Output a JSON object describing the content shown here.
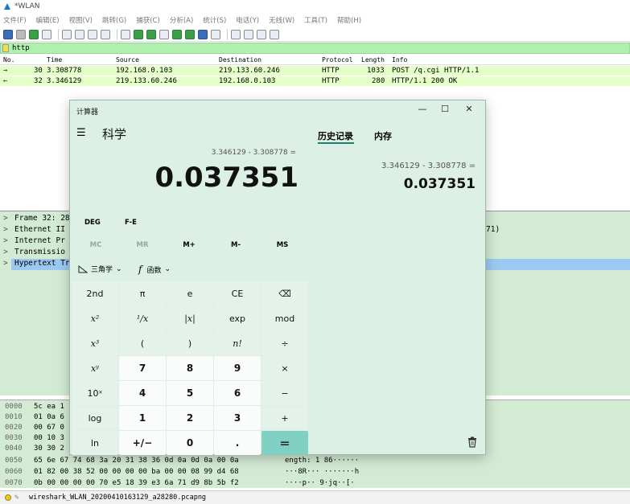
{
  "wireshark": {
    "title": "*WLAN",
    "menu": [
      "文件(F)",
      "编辑(E)",
      "视图(V)",
      "跳转(G)",
      "捕获(C)",
      "分析(A)",
      "统计(S)",
      "电话(Y)",
      "无线(W)",
      "工具(T)",
      "帮助(H)"
    ],
    "filter": "http",
    "columns": {
      "no": "No.",
      "time": "Time",
      "source": "Source",
      "destination": "Destination",
      "protocol": "Protocol",
      "length": "Length",
      "info": "Info"
    },
    "packets": [
      {
        "no": "30",
        "time": "3.308778",
        "source": "192.168.0.103",
        "destination": "219.133.60.246",
        "protocol": "HTTP",
        "length": "1033",
        "info": "POST /q.cgi HTTP/1.1"
      },
      {
        "no": "32",
        "time": "3.346129",
        "source": "219.133.60.246",
        "destination": "192.168.0.103",
        "protocol": "HTTP",
        "length": "280",
        "info": "HTTP/1.1 200 OK"
      }
    ],
    "details": [
      "Frame 32: 28",
      "Ethernet II",
      "Internet Pr",
      "Transmissio",
      "Hypertext Tr"
    ],
    "details_right": "71)",
    "hex": [
      {
        "off": "0000",
        "hex": "5c ea 1",
        "ascii": ""
      },
      {
        "off": "0010",
        "hex": "01 0a 6",
        "ascii": ""
      },
      {
        "off": "0020",
        "hex": "00 67 0",
        "ascii": ""
      },
      {
        "off": "0030",
        "hex": "00 10 3",
        "ascii": ""
      },
      {
        "off": "0040",
        "hex": "30 30 2",
        "ascii": ""
      },
      {
        "off": "0050",
        "hex": "65 6e 67 74 68 3a 20 31   38 36 0d 0a 0d 0a 00 0a",
        "ascii": "ength: 1 86······"
      },
      {
        "off": "0060",
        "hex": "01 82 00 38 52 00 00 00   00 ba 00 00 08 99 d4 68",
        "ascii": "···8R··· ·······h"
      },
      {
        "off": "0070",
        "hex": "0b 00 00 00 00 70 e5 18   39 e3 6a 71 d9 8b 5b f2",
        "ascii": "····p·· 9·jq··[·"
      }
    ],
    "status_file": "wireshark_WLAN_20200410163129_a28280.pcapng"
  },
  "calc": {
    "title": "计算器",
    "mode": "科学",
    "tabs": {
      "history": "历史记录",
      "memory": "内存"
    },
    "expression": "3.346129 - 3.308778 =",
    "display": "0.037351",
    "history": [
      {
        "expression": "3.346129  -  3.308778 =",
        "result": "0.037351"
      }
    ],
    "angle": "DEG",
    "fe": "F-E",
    "memory_buttons": [
      "MC",
      "MR",
      "M+",
      "M-",
      "MS"
    ],
    "trig_label": "三角学",
    "func_label": "函数",
    "keys": [
      [
        "2nd",
        "π",
        "e",
        "CE",
        "⌫"
      ],
      [
        "x²",
        "¹/x",
        "|x|",
        "exp",
        "mod"
      ],
      [
        "x³",
        "(",
        ")",
        "n!",
        "÷"
      ],
      [
        "xʸ",
        "7",
        "8",
        "9",
        "×"
      ],
      [
        "10ˣ",
        "4",
        "5",
        "6",
        "−"
      ],
      [
        "log",
        "1",
        "2",
        "3",
        "+"
      ],
      [
        "ln",
        "+/−",
        "0",
        ".",
        "="
      ]
    ]
  }
}
